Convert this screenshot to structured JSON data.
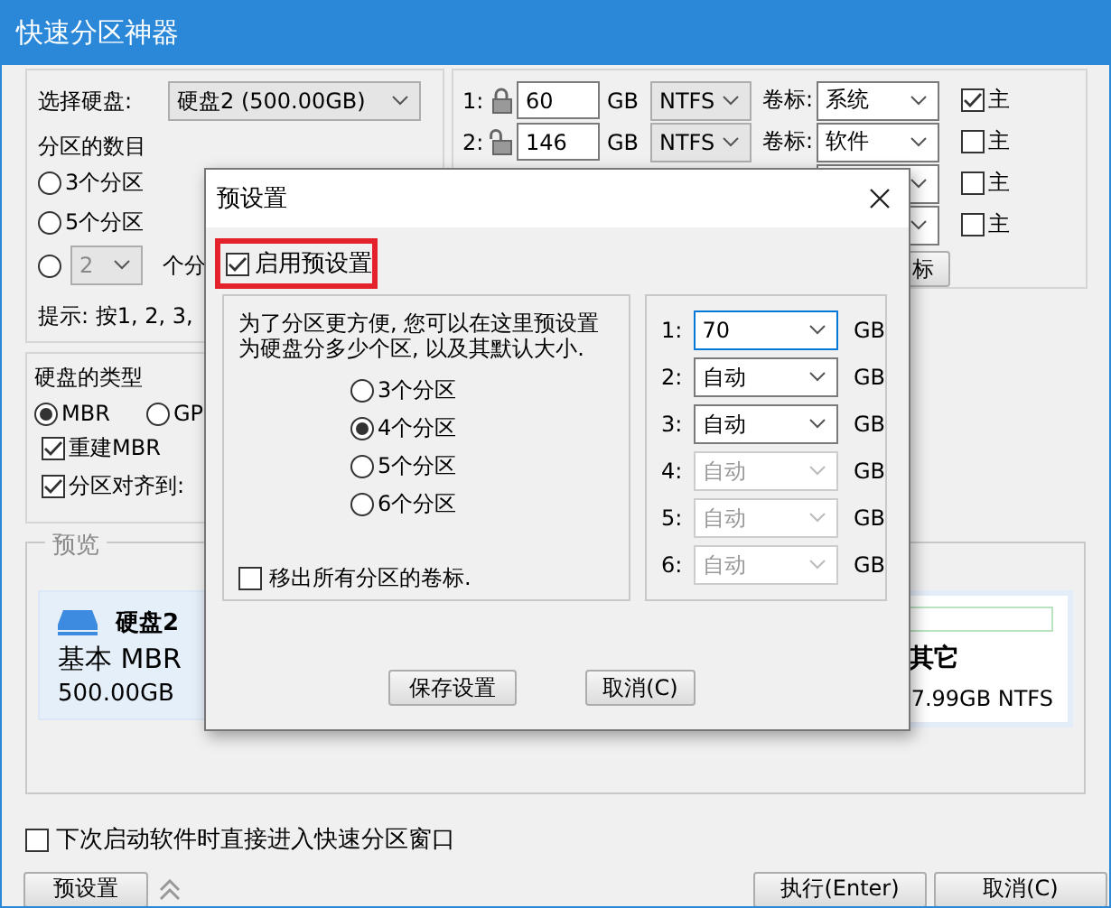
{
  "window": {
    "title": "快速分区神器"
  },
  "disk_select": {
    "label": "选择硬盘:",
    "value": "硬盘2 (500.00GB)"
  },
  "partition_count": {
    "label": "分区的数目",
    "options": [
      {
        "label": "3个分区",
        "selected": false
      },
      {
        "label": "5个分区",
        "selected": false
      }
    ],
    "custom": {
      "selected": false,
      "value": "2",
      "disabled": true,
      "suffix": "个分"
    }
  },
  "hint": "提示: 按1, 2, 3,",
  "partitions": [
    {
      "number": "1:",
      "locked": true,
      "size": "60",
      "unit": "GB",
      "fs": "NTFS",
      "label_caption": "卷标:",
      "label": "系统",
      "primary_label": "主",
      "primary": true
    },
    {
      "number": "2:",
      "locked": false,
      "size": "146",
      "unit": "GB",
      "fs": "NTFS",
      "label_caption": "卷标:",
      "label": "软件",
      "primary_label": "主",
      "primary": false
    },
    {
      "primary_label": "主",
      "primary": false
    },
    {
      "primary_label": "主",
      "primary": false
    }
  ],
  "label_button": "标",
  "disk_type": {
    "label": "硬盘的类型",
    "options": [
      {
        "label": "MBR",
        "selected": true
      },
      {
        "label": "GP",
        "selected": false
      }
    ],
    "checks": [
      {
        "label": "重建MBR",
        "checked": true
      },
      {
        "label": "分区对齐到:",
        "checked": true
      }
    ]
  },
  "preview": {
    "title": "预览",
    "disk": {
      "name": "硬盘2",
      "type": "基本 MBR",
      "size": "500.00GB"
    },
    "partition": {
      "name": "其它",
      "info": "7.99GB NTFS"
    }
  },
  "startup_check": {
    "label": "下次启动软件时直接进入快速分区窗口",
    "checked": false
  },
  "preset_button": "预设置",
  "buttons": [
    "执行(Enter)",
    "取消(C)"
  ],
  "dialog": {
    "title": "预设置",
    "enable": {
      "label": "启用预设置",
      "checked": true
    },
    "description": [
      "为了分区更方便, 您可以在这里预设置",
      "为硬盘分多少个区, 以及其默认大小."
    ],
    "options": [
      {
        "label": "3个分区",
        "selected": false
      },
      {
        "label": "4个分区",
        "selected": true
      },
      {
        "label": "5个分区",
        "selected": false
      },
      {
        "label": "6个分区",
        "selected": false
      }
    ],
    "remove_labels": {
      "label": "移出所有分区的卷标.",
      "checked": false
    },
    "sizes": [
      {
        "number": "1:",
        "value": "70",
        "unit": "GB",
        "disabled": false,
        "focused": true
      },
      {
        "number": "2:",
        "value": "自动",
        "unit": "GB",
        "disabled": false,
        "focused": false
      },
      {
        "number": "3:",
        "value": "自动",
        "unit": "GB",
        "disabled": false,
        "focused": false
      },
      {
        "number": "4:",
        "value": "自动",
        "unit": "GB",
        "disabled": true,
        "focused": false
      },
      {
        "number": "5:",
        "value": "自动",
        "unit": "GB",
        "disabled": true,
        "focused": false
      },
      {
        "number": "6:",
        "value": "自动",
        "unit": "GB",
        "disabled": true,
        "focused": false
      }
    ],
    "buttons": [
      "保存设置",
      "取消(C)"
    ]
  }
}
